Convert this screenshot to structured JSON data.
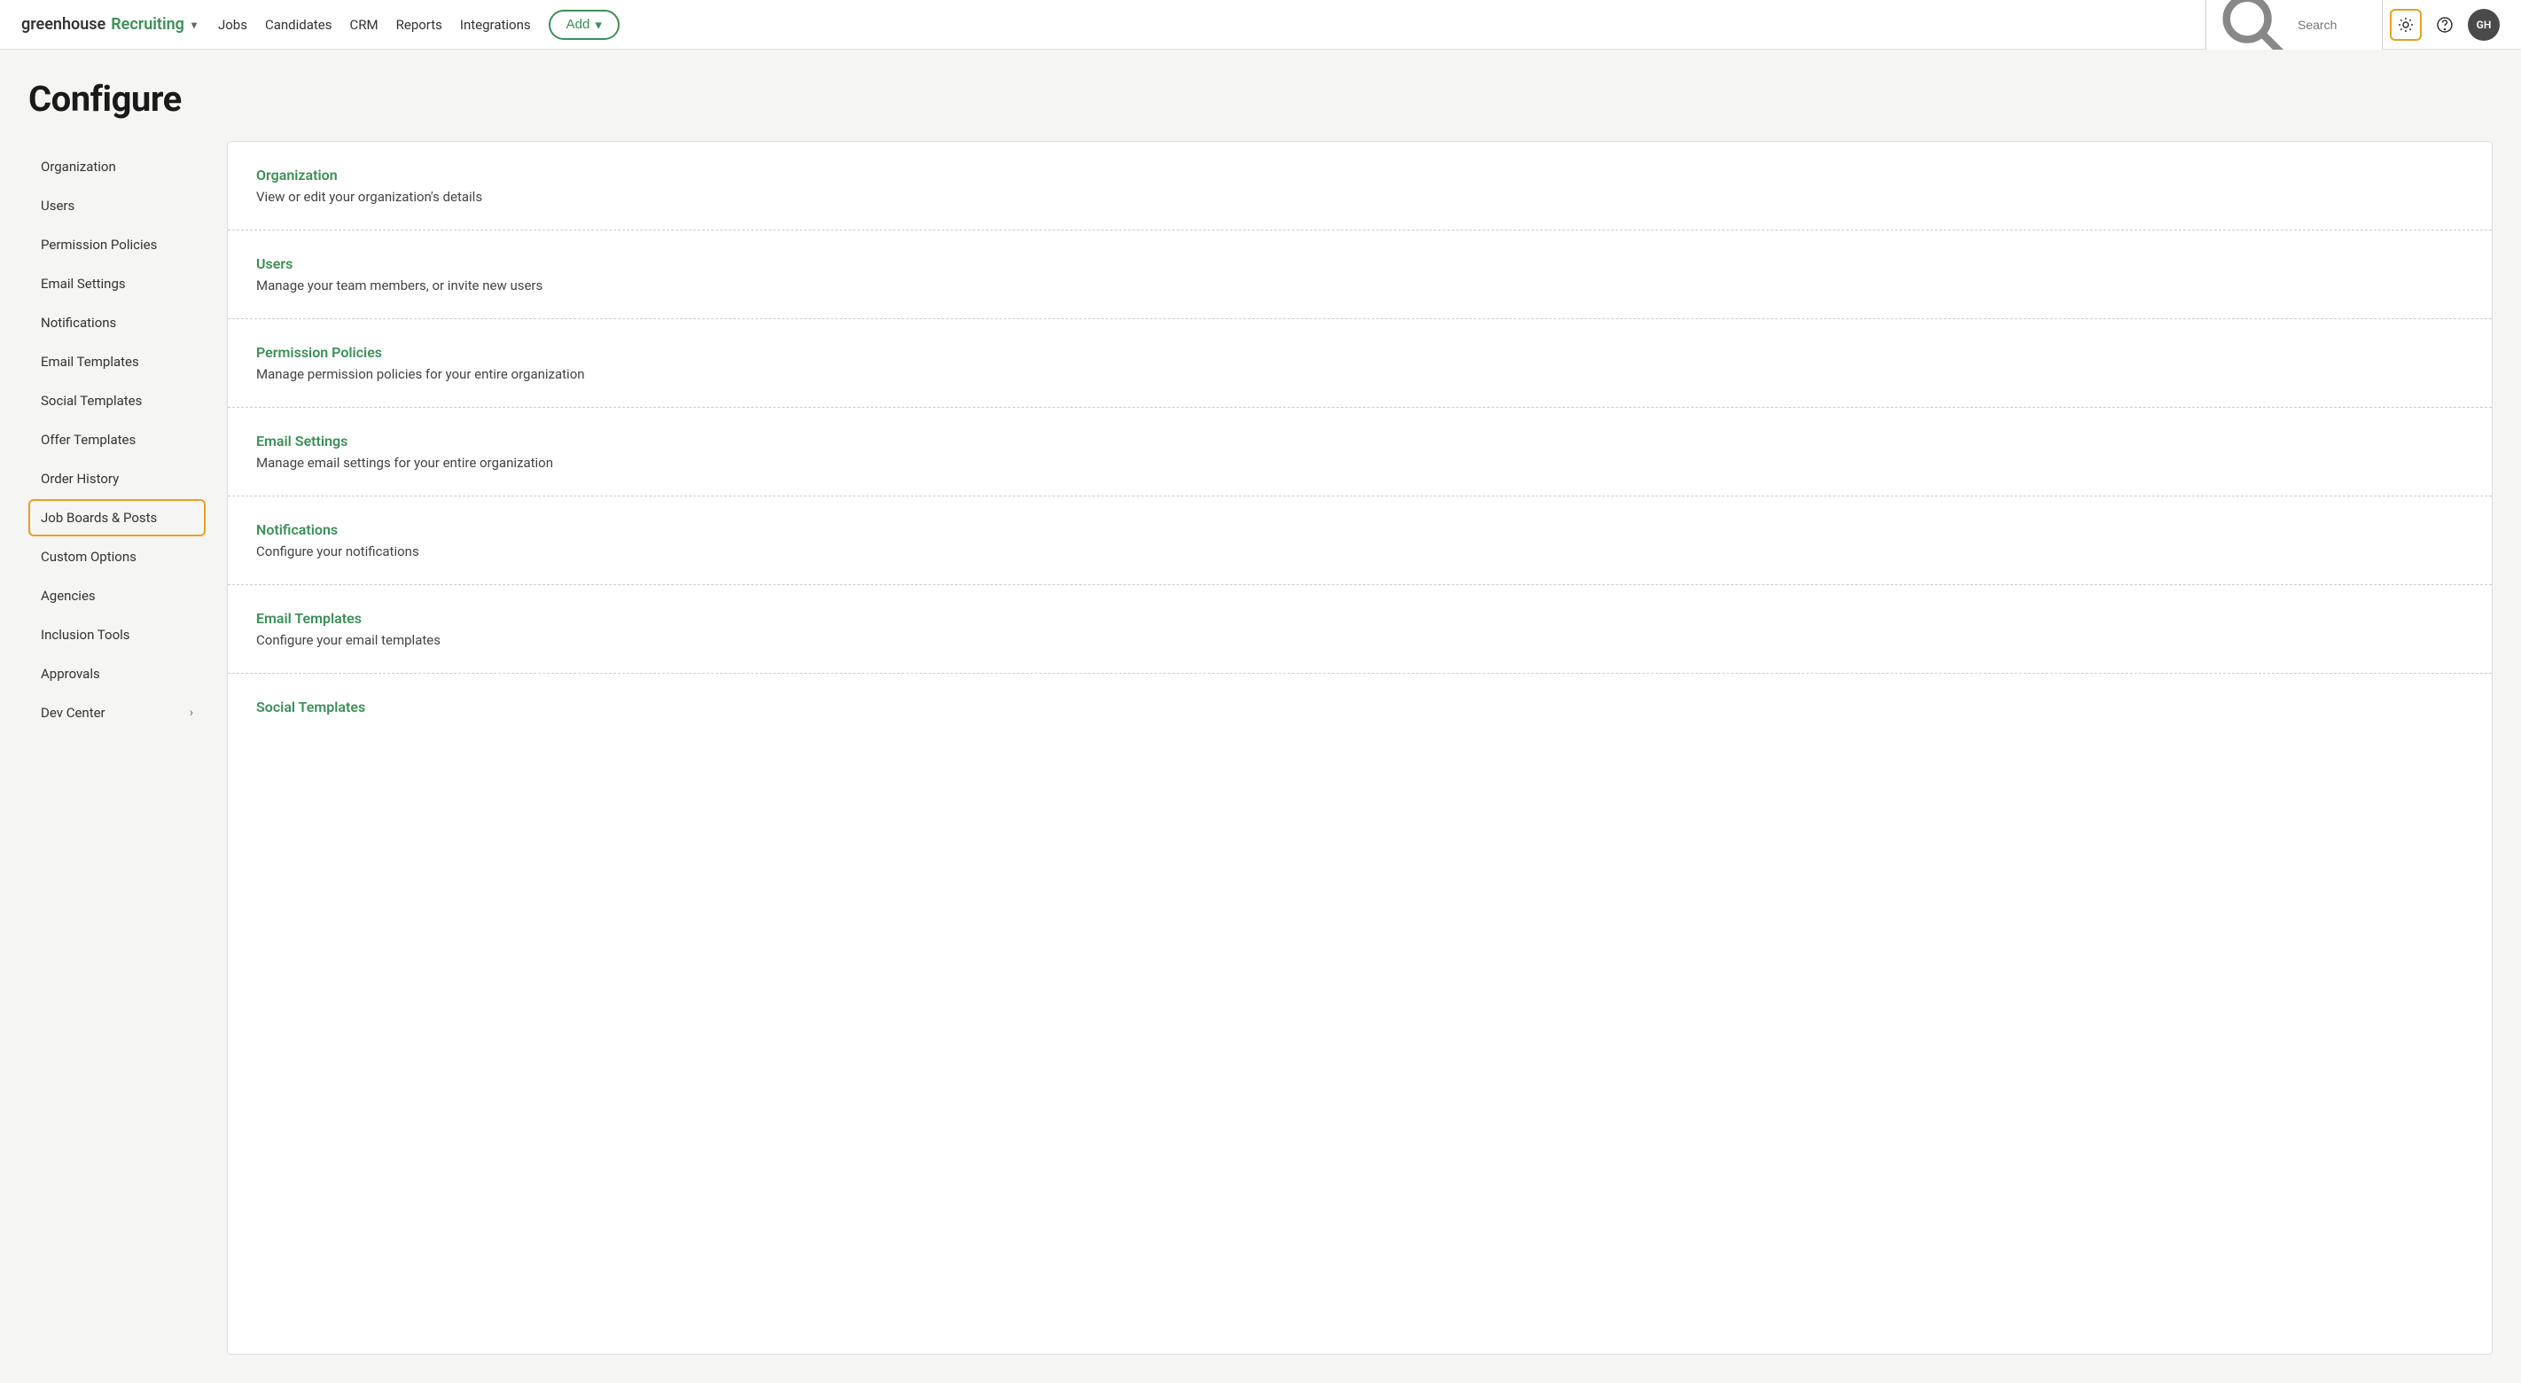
{
  "brand": {
    "name_prefix": "greenhouse",
    "name_highlight": "Recruiting",
    "chevron": "▾"
  },
  "nav": {
    "links": [
      "Jobs",
      "Candidates",
      "CRM",
      "Reports",
      "Integrations"
    ],
    "add_label": "Add",
    "add_chevron": "▾",
    "search_placeholder": "Search"
  },
  "page": {
    "title": "Configure"
  },
  "sidebar": {
    "items": [
      {
        "label": "Organization",
        "active": false,
        "has_chevron": false
      },
      {
        "label": "Users",
        "active": false,
        "has_chevron": false
      },
      {
        "label": "Permission Policies",
        "active": false,
        "has_chevron": false
      },
      {
        "label": "Email Settings",
        "active": false,
        "has_chevron": false
      },
      {
        "label": "Notifications",
        "active": false,
        "has_chevron": false
      },
      {
        "label": "Email Templates",
        "active": false,
        "has_chevron": false
      },
      {
        "label": "Social Templates",
        "active": false,
        "has_chevron": false
      },
      {
        "label": "Offer Templates",
        "active": false,
        "has_chevron": false
      },
      {
        "label": "Order History",
        "active": false,
        "has_chevron": false
      },
      {
        "label": "Job Boards & Posts",
        "active": true,
        "has_chevron": false
      },
      {
        "label": "Custom Options",
        "active": false,
        "has_chevron": false
      },
      {
        "label": "Agencies",
        "active": false,
        "has_chevron": false
      },
      {
        "label": "Inclusion Tools",
        "active": false,
        "has_chevron": false
      },
      {
        "label": "Approvals",
        "active": false,
        "has_chevron": false
      },
      {
        "label": "Dev Center",
        "active": false,
        "has_chevron": true
      }
    ]
  },
  "sections": [
    {
      "title": "Organization",
      "description": "View or edit your organization's details"
    },
    {
      "title": "Users",
      "description": "Manage your team members, or invite new users"
    },
    {
      "title": "Permission Policies",
      "description": "Manage permission policies for your entire organization"
    },
    {
      "title": "Email Settings",
      "description": "Manage email settings for your entire organization"
    },
    {
      "title": "Notifications",
      "description": "Configure your notifications"
    },
    {
      "title": "Email Templates",
      "description": "Configure your email templates"
    },
    {
      "title": "Social Templates",
      "description": ""
    }
  ],
  "icons": {
    "search": "search-icon",
    "gear": "gear-icon",
    "help": "help-icon",
    "avatar_initials": "GH"
  }
}
